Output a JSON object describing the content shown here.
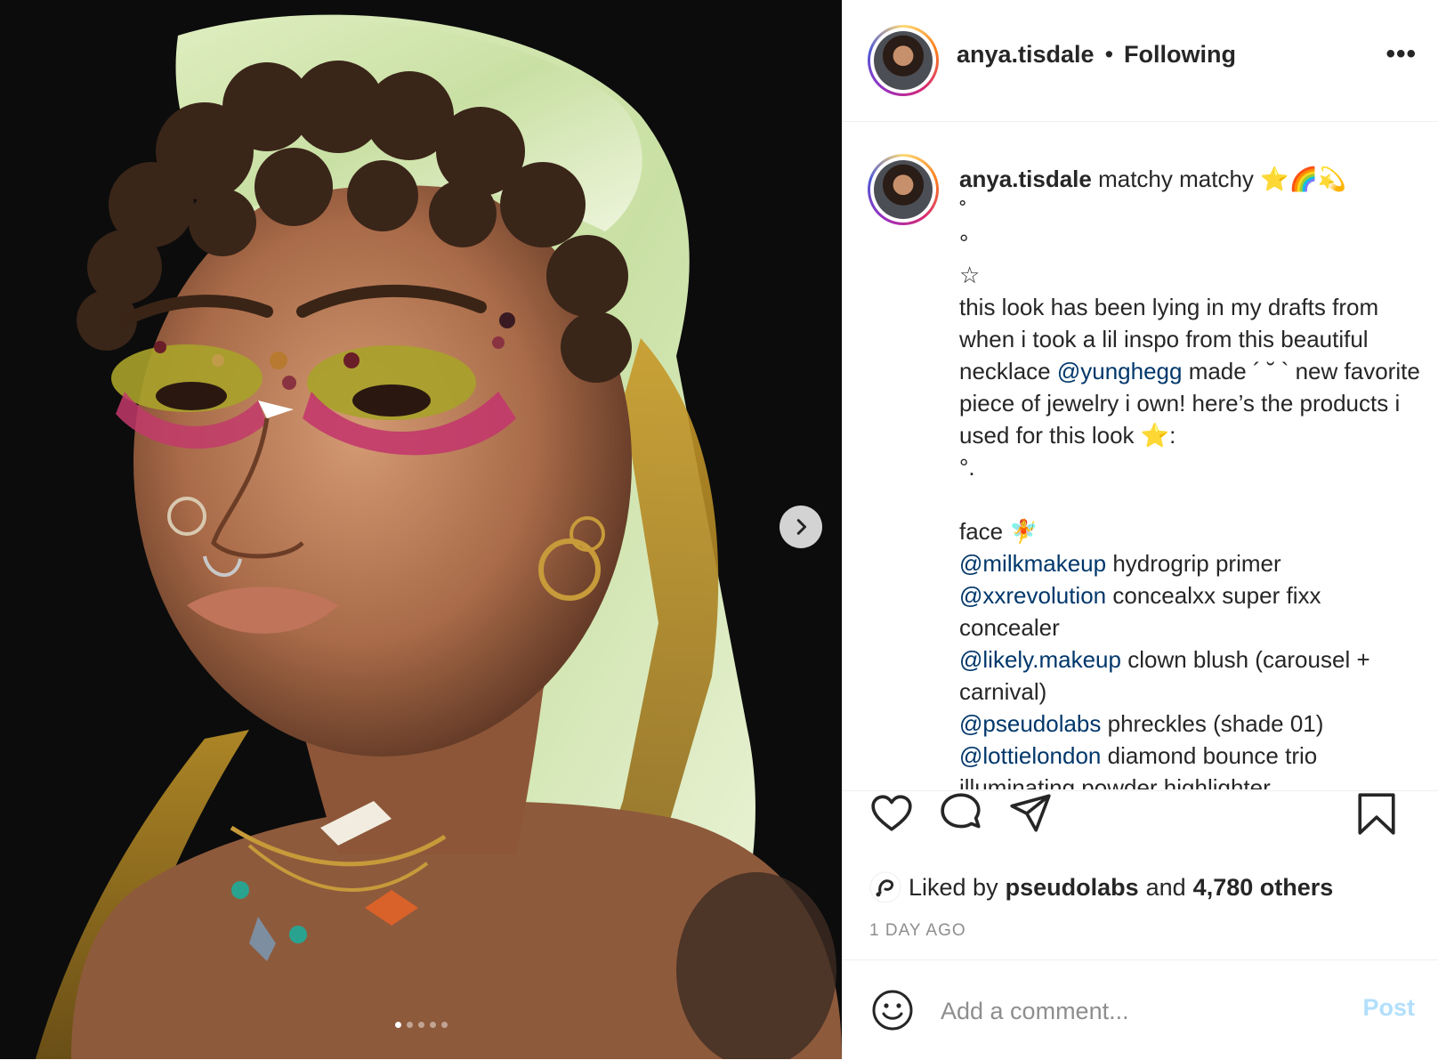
{
  "header": {
    "username": "anya.tisdale",
    "separator": "•",
    "follow_status": "Following",
    "more_label": "•••"
  },
  "caption": {
    "username": "anya.tisdale",
    "parts": [
      {
        "t": "text",
        "v": " matchy matchy ⭐🌈💫\n˚\n°\n☆\nthis look has been lying in my drafts from when i took a lil inspo from this beautiful necklace "
      },
      {
        "t": "mention",
        "v": "@yunghegg"
      },
      {
        "t": "text",
        "v": " made ´ ˘ ` new favorite piece of jewelry i own! here’s the products i used for this look ⭐:\n°.\n\nface 🧚\n"
      },
      {
        "t": "mention",
        "v": "@milkmakeup"
      },
      {
        "t": "text",
        "v": " hydrogrip primer\n"
      },
      {
        "t": "mention",
        "v": "@xxrevolution"
      },
      {
        "t": "text",
        "v": " concealxx super fixx concealer\n"
      },
      {
        "t": "mention",
        "v": "@likely.makeup"
      },
      {
        "t": "text",
        "v": " clown blush (carousel + carnival)\n"
      },
      {
        "t": "mention",
        "v": "@pseudolabs"
      },
      {
        "t": "text",
        "v": " phreckles (shade 01)\n"
      },
      {
        "t": "mention",
        "v": "@lottielondon"
      },
      {
        "t": "text",
        "v": " diamond bounce trio illuminating powder highlighter\n˚"
      }
    ]
  },
  "likes": {
    "prefix": "Liked by",
    "liker": "pseudolabs",
    "conjunction": "and",
    "others": "4,780 others"
  },
  "timestamp": "1 DAY AGO",
  "comment": {
    "placeholder": "Add a comment...",
    "post_label": "Post"
  },
  "carousel": {
    "count": 5,
    "active": 0
  },
  "colors": {
    "mention": "#00376b",
    "post_button": "#b2dffc",
    "muted": "#8e8e8e",
    "divider": "#efefef"
  }
}
